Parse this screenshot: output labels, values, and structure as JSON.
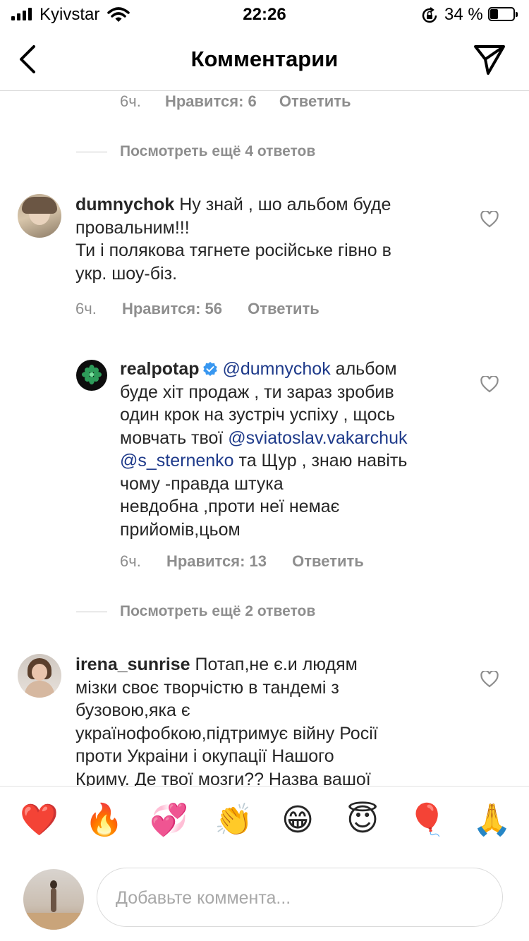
{
  "status_bar": {
    "carrier": "Kyivstar",
    "time": "22:26",
    "battery_percent": "34 %"
  },
  "header": {
    "title": "Комментарии",
    "back_icon": "chevron-left-icon",
    "share_icon": "direct-share-icon"
  },
  "top_reply_meta": {
    "time": "6ч.",
    "likes": "Нравится: 6",
    "reply": "Ответить"
  },
  "more_replies_1": "Посмотреть ещё 4 ответов",
  "comment_1": {
    "username": "dumnychok",
    "text_line1": " Ну знай , шо альбом буде",
    "text_line2": "провальним!!!",
    "text_line3": "Ти і полякова тягнете російське гівно в",
    "text_line4": "укр. шоу-біз.",
    "time": "6ч.",
    "likes": "Нравится: 56",
    "reply": "Ответить"
  },
  "reply_1": {
    "username": "realpotap",
    "mention1": "@dumnychok",
    "line1_rest": " альбом",
    "line2": "буде хіт продаж , ти зараз зробив",
    "line3": "один крок на зустріч успіху , щось",
    "line4_start": "мовчать твої ",
    "mention2": "@sviatoslav.vakarchuk",
    "mention3": "@s_sternenko",
    "line5_rest": " та Щур , знаю навіть",
    "line6": "чому -правда штука",
    "line7": "невдобна ,проти неї немає",
    "line8": "прийомів,цьом",
    "time": "6ч.",
    "likes": "Нравится: 13",
    "reply": "Ответить"
  },
  "more_replies_2": "Посмотреть ещё 2 ответов",
  "comment_2": {
    "username": "irena_sunrise",
    "line1_rest": " Потап,не є.и людям",
    "line2": "мізки своє творчістю в тандемі з",
    "line3": "бузовою,яка є",
    "line4": "українофобкою,підтримує війну Росії",
    "line5": "проти Украіни і окупації Нашого",
    "line6": "Криму. Де твої мозги?? Назва вашої"
  },
  "emoji_bar": {
    "emojis": [
      "❤️",
      "🔥",
      "💞",
      "👏",
      "😁",
      "😇",
      "🎈",
      "🙏"
    ]
  },
  "comment_input": {
    "placeholder": "Добавьте коммента..."
  },
  "colors": {
    "mention": "#1e3a8a",
    "secondary_text": "#8e8e8e",
    "divider": "#dbdbdb"
  }
}
